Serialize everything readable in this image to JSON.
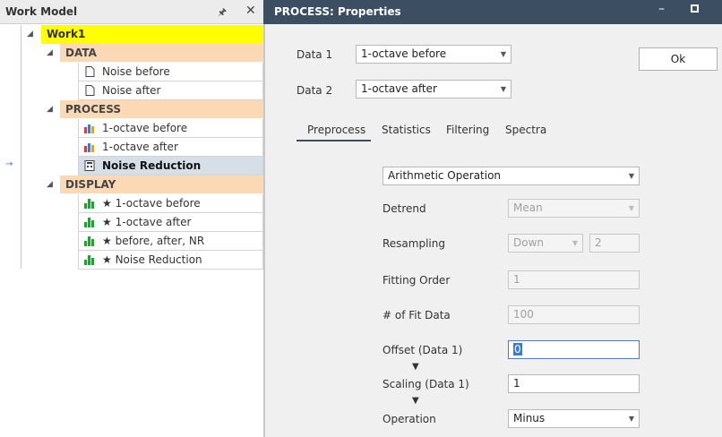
{
  "left_panel": {
    "title": "Work Model",
    "root": "Work1",
    "groups": [
      {
        "name": "DATA",
        "items": [
          {
            "label": "Noise before",
            "icon": "document-icon"
          },
          {
            "label": "Noise after",
            "icon": "document-icon"
          }
        ]
      },
      {
        "name": "PROCESS",
        "items": [
          {
            "label": "1-octave before",
            "icon": "bar-chart-color-icon"
          },
          {
            "label": "1-octave after",
            "icon": "bar-chart-color-icon"
          },
          {
            "label": "Noise Reduction",
            "icon": "calculator-icon",
            "selected": true
          }
        ]
      },
      {
        "name": "DISPLAY",
        "items": [
          {
            "label": "★ 1-octave before",
            "icon": "bar-chart-green-icon"
          },
          {
            "label": "★ 1-octave after",
            "icon": "bar-chart-green-icon"
          },
          {
            "label": "★ before, after, NR",
            "icon": "bar-chart-green-icon"
          },
          {
            "label": "★ Noise Reduction",
            "icon": "bar-chart-green-icon"
          }
        ]
      }
    ]
  },
  "dialog": {
    "title": "PROCESS: Properties",
    "ok_label": "Ok",
    "data1": {
      "label": "Data 1",
      "value": "1-octave before"
    },
    "data2": {
      "label": "Data 2",
      "value": "1-octave after"
    },
    "tabs": [
      "Preprocess",
      "Statistics",
      "Filtering",
      "Spectra"
    ],
    "active_tab": "Preprocess",
    "operation_type": "Arithmetic Operation",
    "detrend": {
      "label": "Detrend",
      "value": "Mean"
    },
    "resampling": {
      "label": "Resampling",
      "mode": "Down",
      "factor": "2"
    },
    "fitting_order": {
      "label": "Fitting Order",
      "value": "1"
    },
    "fit_data": {
      "label": "# of Fit Data",
      "value": "100"
    },
    "offset": {
      "label": "Offset (Data 1)",
      "value": "0"
    },
    "scaling": {
      "label": "Scaling (Data 1)",
      "value": "1"
    },
    "operation": {
      "label": "Operation",
      "value": "Minus"
    }
  },
  "colors": {
    "header_dark": "#3c4e61",
    "group_bg": "#fbd9b5",
    "root_bg": "#ffff00",
    "selected_bg": "#d6dfe8"
  }
}
